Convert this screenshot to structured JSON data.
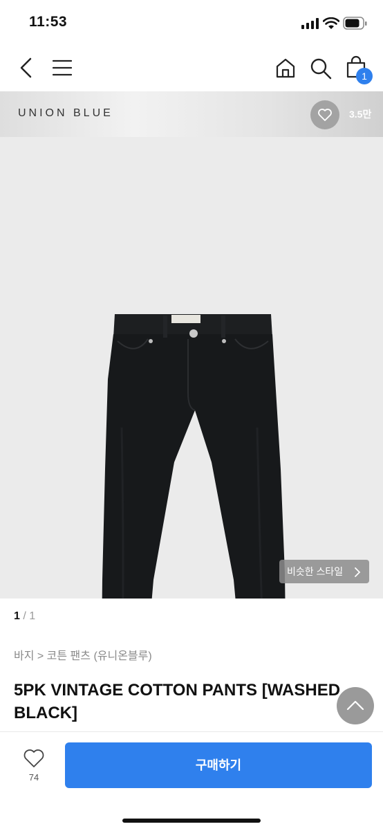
{
  "status_bar": {
    "time": "11:53"
  },
  "nav": {
    "icons": [
      "back-icon",
      "menu-icon",
      "home-icon",
      "search-icon",
      "cart-icon"
    ],
    "cart_badge": "1"
  },
  "brand": {
    "name": "UNION BLUE",
    "like_count": "3.5만"
  },
  "image": {
    "similar_style_label": "비슷한 스타일",
    "counter_current": "1",
    "counter_total": " / 1"
  },
  "product": {
    "breadcrumb": "바지 > 코튼 팬츠 (유니온블루)",
    "title": "5PK VINTAGE COTTON PANTS [WASHED BLACK]"
  },
  "bottom_bar": {
    "like_count": "74",
    "buy_label": "구매하기"
  },
  "colors": {
    "accent": "#2f80ed",
    "image_bg": "#ebebeb",
    "pants": "#17191b"
  }
}
